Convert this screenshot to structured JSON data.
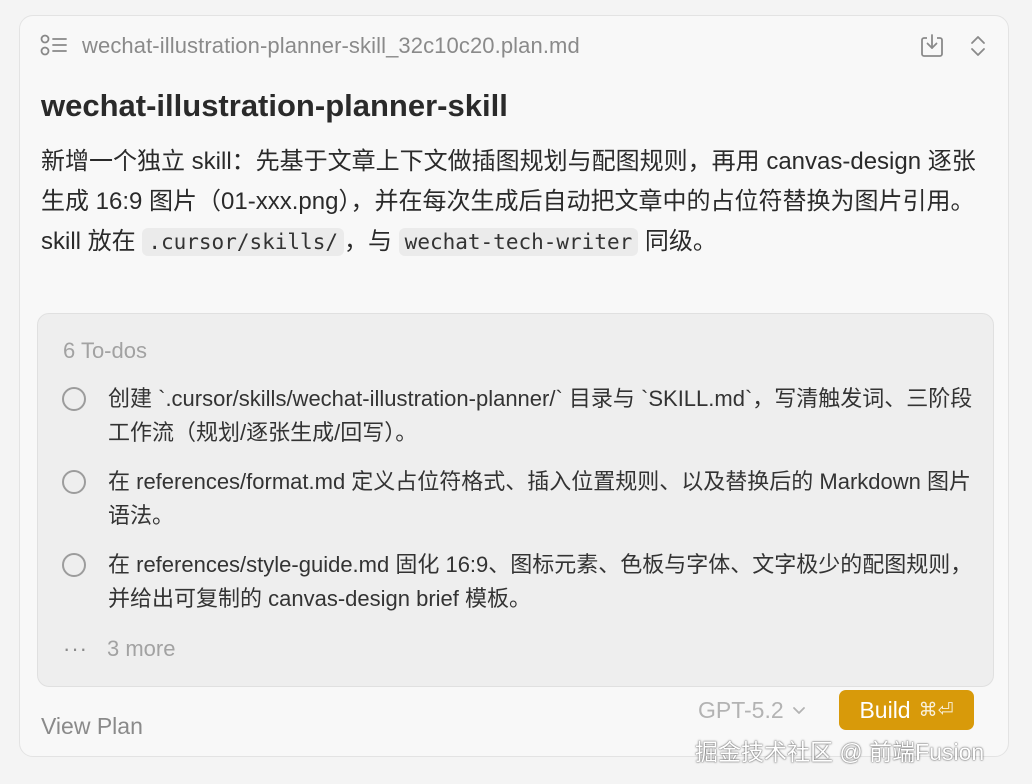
{
  "header": {
    "file_name": "wechat-illustration-planner-skill_32c10c20.plan.md",
    "icons": [
      "plan-list-icon",
      "download-icon",
      "expand-collapse-icon"
    ]
  },
  "plan": {
    "title": "wechat-illustration-planner-skill",
    "description_part1": "新增一个独立 skill：先基于文章上下文做插图规划与配图规则，再用 canvas-design 逐张生成 16:9 图片（01-xxx.png），并在每次生成后自动把文章中的占位符替换为图片引用。skill 放在 ",
    "code1": ".cursor/skills/",
    "description_part2": "，与 ",
    "code2": "wechat-tech-writer",
    "description_part3": " 同级。"
  },
  "todos": {
    "count_label": "6 To-dos",
    "items": [
      {
        "text": "创建 `.cursor/skills/wechat-illustration-planner/` 目录与 `SKILL.md`，写清触发词、三阶段工作流（规划/逐张生成/回写）。"
      },
      {
        "text": "在 references/format.md 定义占位符格式、插入位置规则、以及替换后的 Markdown 图片语法。"
      },
      {
        "text": "在 references/style-guide.md 固化 16:9、图标元素、色板与字体、文字极少的配图规则，并给出可复制的 canvas-design brief 模板。"
      }
    ],
    "more_dots": "···",
    "more_label": "3 more"
  },
  "footer": {
    "view_plan": "View Plan",
    "model": "GPT-5.2",
    "build_label": "Build",
    "build_shortcut": "⌘⏎"
  },
  "watermark": "掘金技术社区 @ 前端Fusion",
  "colors": {
    "accent": "#d89a0a",
    "background": "#f4f4f4",
    "muted_text": "#8a8a8a"
  }
}
